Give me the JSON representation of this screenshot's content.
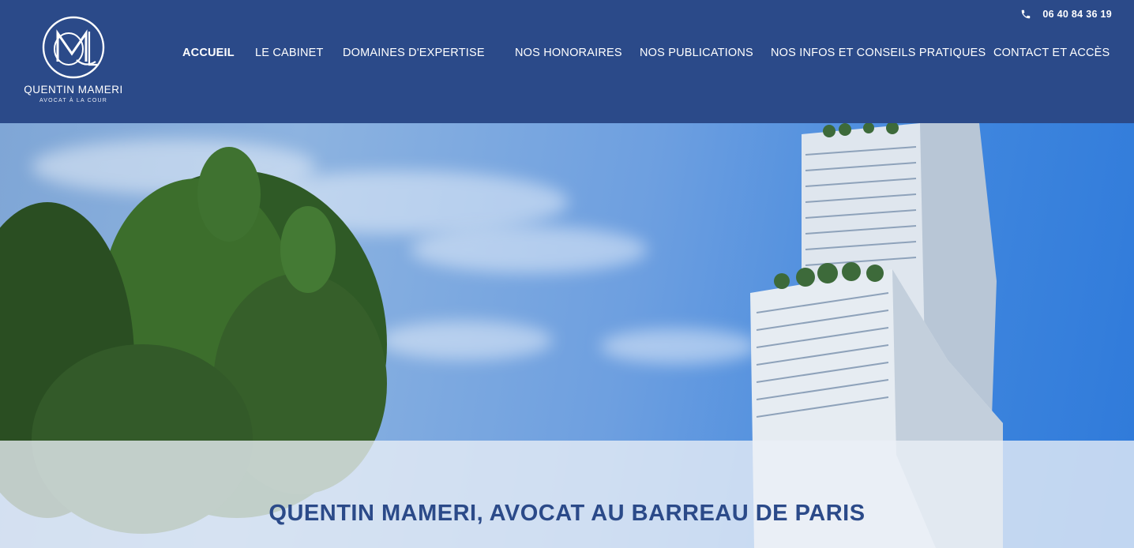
{
  "brand": {
    "name": "QUENTIN MAMERI",
    "subtitle": "AVOCAT À LA COUR",
    "monogram": "QM"
  },
  "contact": {
    "phone": "06 40 84 36 19",
    "icon": "phone-icon"
  },
  "nav": {
    "items": [
      {
        "label": "ACCUEIL",
        "active": true
      },
      {
        "label": "LE CABINET",
        "active": false
      },
      {
        "label": "DOMAINES D'EXPERTISE",
        "active": false
      },
      {
        "label": "NOS HONORAIRES",
        "active": false
      },
      {
        "label": "NOS PUBLICATIONS",
        "active": false
      },
      {
        "label": "NOS INFOS ET CONSEILS PRATIQUES",
        "active": false
      },
      {
        "label": "CONTACT ET ACCÈS",
        "active": false
      }
    ]
  },
  "hero": {
    "title": "QUENTIN MAMERI, AVOCAT AU BARREAU DE PARIS",
    "image": "Paris courthouse tower with trees and blue sky"
  },
  "colors": {
    "header_bg": "#2b4a89",
    "accent": "#2b4a89",
    "text_light": "#ffffff"
  }
}
